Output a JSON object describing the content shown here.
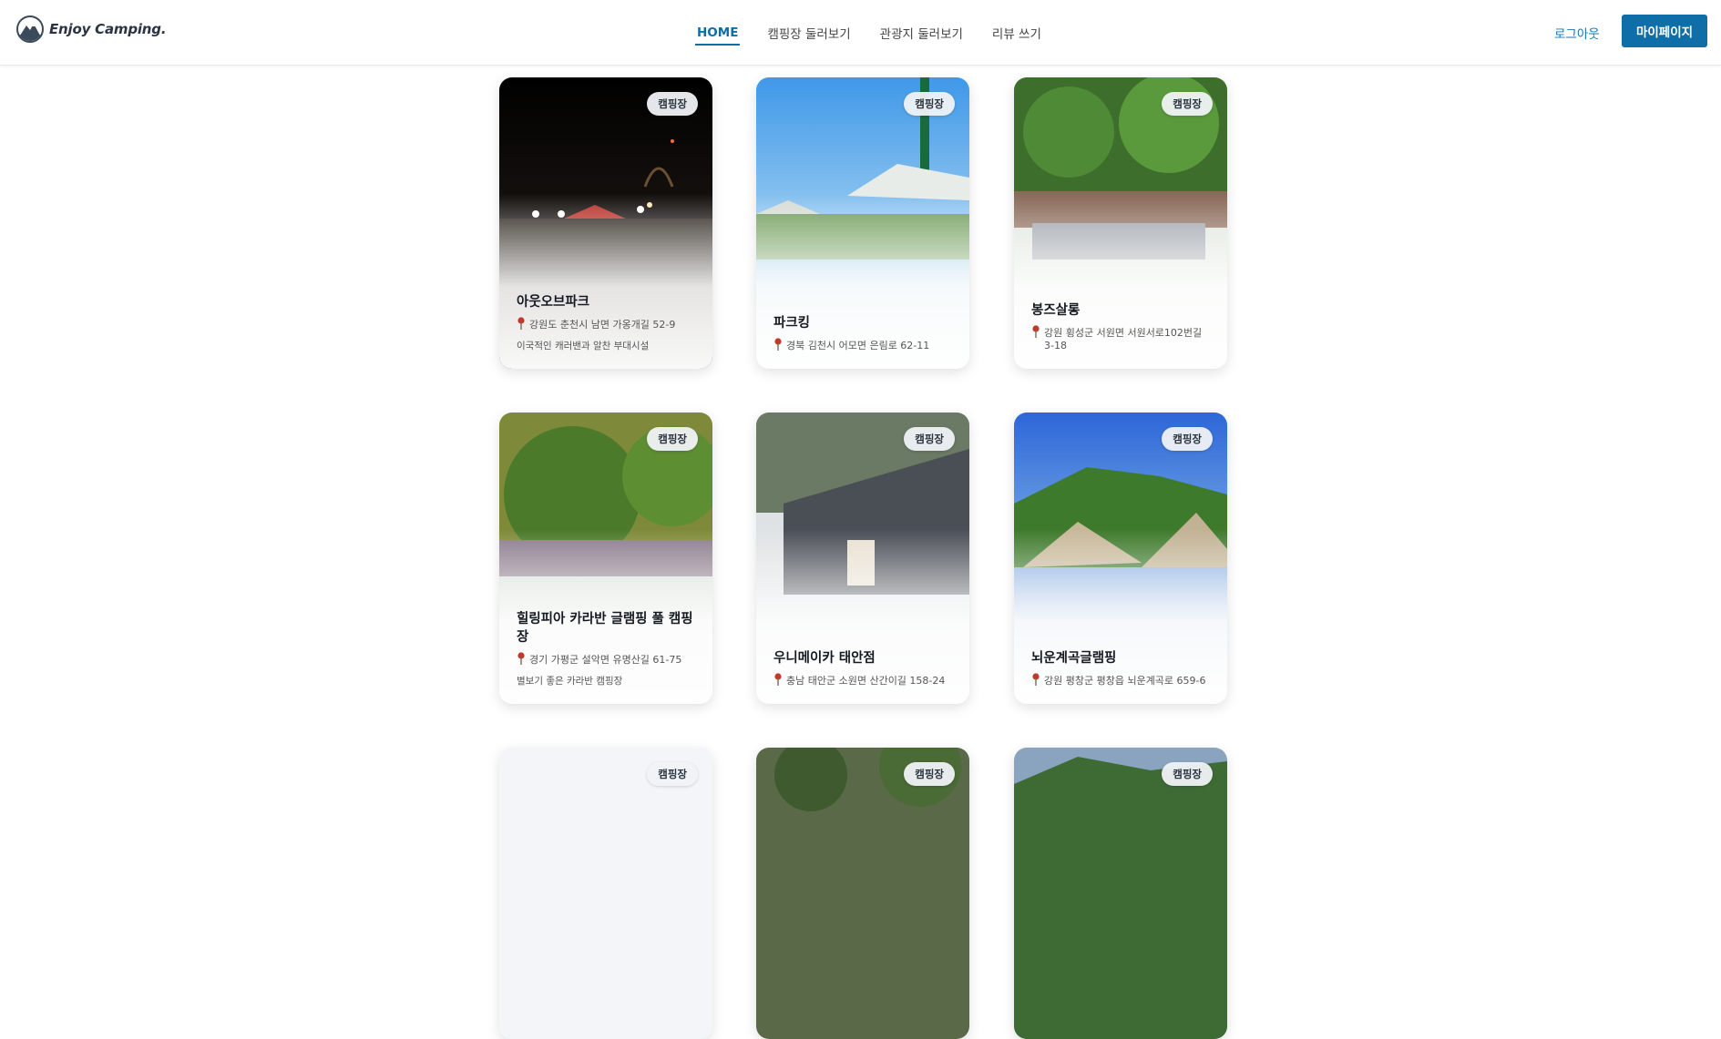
{
  "header": {
    "logo_text": "Enjoy Camping.",
    "nav": [
      {
        "label": "HOME",
        "active": true
      },
      {
        "label": "캠핑장 둘러보기",
        "active": false
      },
      {
        "label": "관광지 둘러보기",
        "active": false
      },
      {
        "label": "리뷰 쓰기",
        "active": false
      }
    ],
    "logout_label": "로그아웃",
    "mypage_label": "마이페이지"
  },
  "cards": [
    {
      "badge": "캠핑장",
      "name": "아웃오브파크",
      "address": "강원도 춘천시 남면 가옹개길 52-9",
      "description": "이국적인 캐러밴과 알찬 부대시설"
    },
    {
      "badge": "캠핑장",
      "name": "파크킹",
      "address": "경북 김천시 어모면 은림로 62-11",
      "description": ""
    },
    {
      "badge": "캠핑장",
      "name": "봉즈살롱",
      "address": "강원 횡성군 서원면 서원서로102번길 3-18",
      "description": ""
    },
    {
      "badge": "캠핑장",
      "name": "힐링피아 카라반 글램핑 풀 캠핑장",
      "address": "경기 가평군 설악면 유명산길 61-75",
      "description": "별보기 좋은 카라반 캠핑장"
    },
    {
      "badge": "캠핑장",
      "name": "우니메이카 태안점",
      "address": "충남 태안군 소원면 산간이길 158-24",
      "description": ""
    },
    {
      "badge": "캠핑장",
      "name": "뇌운계곡글램핑",
      "address": "강원 평창군 평창읍 뇌운계곡로 659-6",
      "description": ""
    },
    {
      "badge": "캠핑장",
      "name": "",
      "address": "",
      "description": ""
    },
    {
      "badge": "캠핑장",
      "name": "",
      "address": "",
      "description": ""
    },
    {
      "badge": "캠핑장",
      "name": "",
      "address": "",
      "description": ""
    }
  ],
  "colors": {
    "brand": "#0f6ea8",
    "pin": "#c0392b"
  }
}
